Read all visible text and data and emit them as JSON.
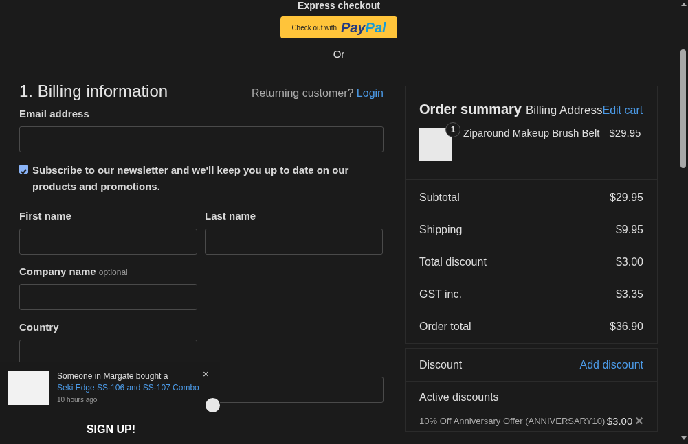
{
  "express": {
    "title": "Express checkout",
    "button_prefix": "Check out with",
    "logo_parts": [
      "Pay",
      "Pal"
    ]
  },
  "divider_text": "Or",
  "billing": {
    "heading": "1. Billing information",
    "returning_prompt": "Returning customer?",
    "login_link": "Login",
    "email": {
      "label": "Email address"
    },
    "newsletter": {
      "label": "Subscribe to our newsletter and we'll keep you up to date on our products and promotions.",
      "checked": true
    },
    "name_fields": [
      {
        "label": "First name"
      },
      {
        "label": "Last name"
      }
    ],
    "company": {
      "label": "Company name",
      "hint": "optional"
    },
    "country": {
      "label": "Country"
    }
  },
  "summary": {
    "title": "Order summary",
    "subtitle": "Billing Address",
    "edit_link": "Edit cart",
    "items": [
      {
        "name": "Ziparound Makeup Brush Belt",
        "price": "$29.95",
        "quantity": "1"
      }
    ],
    "totals": [
      {
        "label": "Subtotal",
        "value": "$29.95"
      },
      {
        "label": "Shipping",
        "value": "$9.95"
      },
      {
        "label": "Total discount",
        "value": "$3.00"
      },
      {
        "label": "GST inc.",
        "value": "$3.35"
      },
      {
        "label": "Order total",
        "value": "$36.90"
      }
    ],
    "discount": {
      "label": "Discount",
      "add_link": "Add discount",
      "active_heading": "Active discounts",
      "active": [
        {
          "name": "10% Off Anniversary Offer (ANNIVERSARY10)",
          "amount": "$3.00",
          "remove": "×"
        }
      ]
    }
  },
  "notification": {
    "message": "Someone in Margate bought a",
    "product_link": "Seki Edge SS-106 and SS-107 Combo",
    "time": "10 hours ago",
    "close": "×"
  },
  "signup": {
    "label": "SIGN UP!"
  }
}
